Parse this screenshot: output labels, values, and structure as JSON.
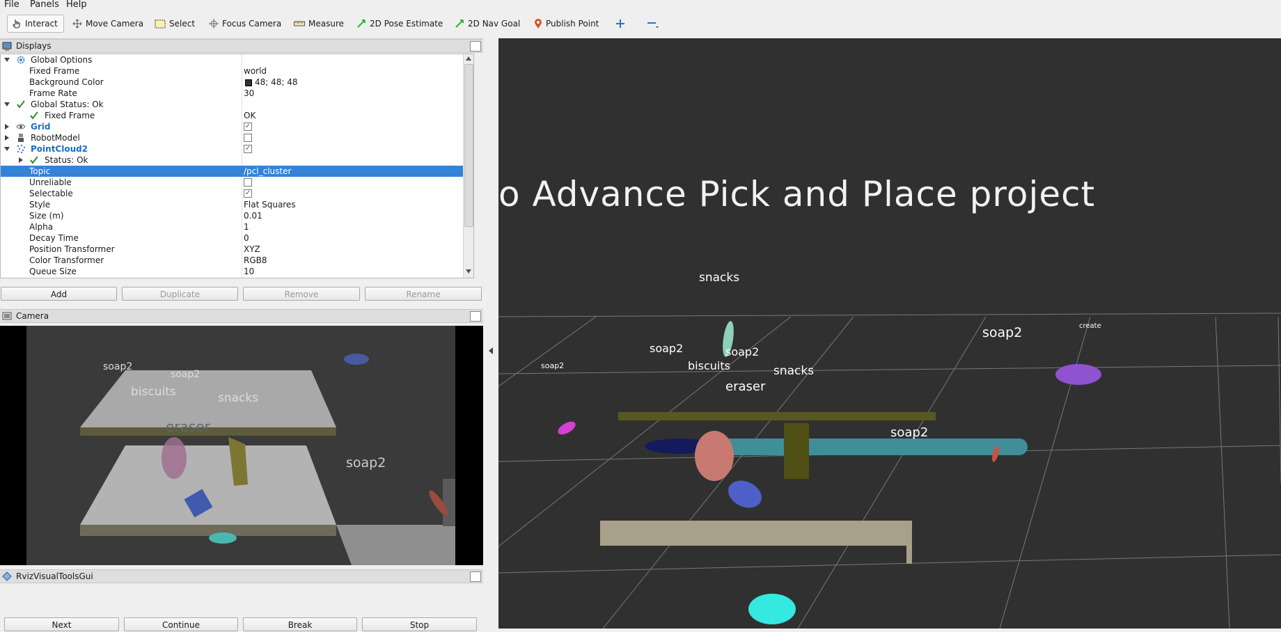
{
  "menu": {
    "file": "File",
    "panels": "Panels",
    "help": "Help"
  },
  "toolbar": {
    "interact": "Interact",
    "move_camera": "Move Camera",
    "select": "Select",
    "focus_camera": "Focus Camera",
    "measure": "Measure",
    "pose_estimate": "2D Pose Estimate",
    "nav_goal": "2D Nav Goal",
    "publish_point": "Publish Point"
  },
  "displays": {
    "title": "Displays",
    "rows": [
      {
        "name": "Global Options",
        "value": ""
      },
      {
        "name": "Fixed Frame",
        "value": "world"
      },
      {
        "name": "Background Color",
        "value": "48; 48; 48"
      },
      {
        "name": "Frame Rate",
        "value": "30"
      },
      {
        "name": "Global Status: Ok",
        "value": ""
      },
      {
        "name": "Fixed Frame",
        "value": "OK"
      },
      {
        "name": "Grid",
        "value": ""
      },
      {
        "name": "RobotModel",
        "value": ""
      },
      {
        "name": "PointCloud2",
        "value": ""
      },
      {
        "name": "Status: Ok",
        "value": ""
      },
      {
        "name": "Topic",
        "value": "/pcl_cluster"
      },
      {
        "name": "Unreliable",
        "value": ""
      },
      {
        "name": "Selectable",
        "value": ""
      },
      {
        "name": "Style",
        "value": "Flat Squares"
      },
      {
        "name": "Size (m)",
        "value": "0.01"
      },
      {
        "name": "Alpha",
        "value": "1"
      },
      {
        "name": "Decay Time",
        "value": "0"
      },
      {
        "name": "Position Transformer",
        "value": "XYZ"
      },
      {
        "name": "Color Transformer",
        "value": "RGB8"
      },
      {
        "name": "Queue Size",
        "value": "10"
      }
    ],
    "checks": {
      "grid": true,
      "robotmodel": false,
      "pointcloud2": true,
      "unreliable": false,
      "selectable": true
    },
    "background_color_swatch": "#303030",
    "selected_row": "Topic",
    "buttons": {
      "add": "Add",
      "duplicate": "Duplicate",
      "remove": "Remove",
      "rename": "Rename"
    }
  },
  "camera": {
    "title": "Camera",
    "labels": {
      "soap2_a": "soap2",
      "soap2_b": "soap2",
      "biscuits": "biscuits",
      "snacks": "snacks",
      "eraser": "eraser",
      "soap2_c": "soap2"
    }
  },
  "rviz_tools": {
    "title": "RvizVisualToolsGui",
    "buttons": {
      "next": "Next",
      "continue": "Continue",
      "break": "Break",
      "stop": "Stop"
    }
  },
  "viewport": {
    "background": "#303030",
    "banner": "o  Advance  Pick  and  Place  project",
    "labels": {
      "snacks_top": "snacks",
      "soap2_right": "soap2",
      "create": "create",
      "soap2_left": "soap2",
      "soap2_mid": "soap2",
      "soap2_center": "soap2",
      "biscuits": "biscuits",
      "snacks": "snacks",
      "eraser": "eraser",
      "soap2_low": "soap2"
    }
  },
  "colors": {
    "selection": "#3483d6",
    "link_blue": "#1a6fc4",
    "ok_green": "#2c8a2c"
  }
}
